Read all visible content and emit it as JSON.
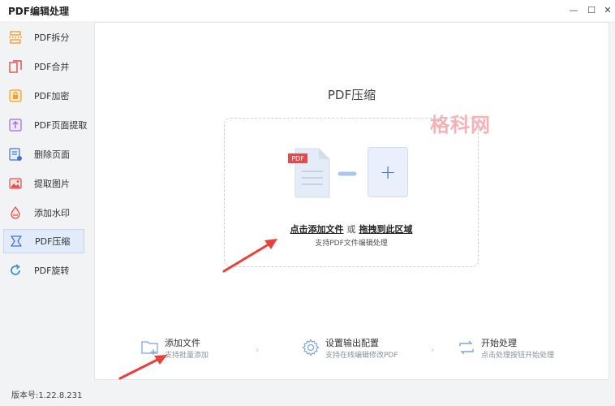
{
  "app": {
    "title": "PDF编辑处理"
  },
  "window": {
    "min_glyph": "—",
    "max_glyph": "☐",
    "close_glyph": "✕"
  },
  "sidebar": {
    "items": [
      {
        "label": "PDF拆分",
        "icon": "split-icon"
      },
      {
        "label": "PDF合并",
        "icon": "merge-icon"
      },
      {
        "label": "PDF加密",
        "icon": "lock-icon"
      },
      {
        "label": "PDF页面提取",
        "icon": "extract-icon"
      },
      {
        "label": "删除页面",
        "icon": "delete-page-icon"
      },
      {
        "label": "提取图片",
        "icon": "image-icon"
      },
      {
        "label": "添加水印",
        "icon": "watermark-icon"
      },
      {
        "label": "PDF压缩",
        "icon": "compress-icon",
        "active": true
      },
      {
        "label": "PDF旋转",
        "icon": "rotate-icon"
      }
    ]
  },
  "main": {
    "title": "PDF压缩",
    "watermark": "格科网",
    "dropzone": {
      "badge": "PDF",
      "plus": "+",
      "click_add": "点击添加文件",
      "or": "或",
      "drag_here": "拖拽到此区域",
      "hint": "支持PDF文件编辑处理"
    },
    "steps": [
      {
        "title": "添加文件",
        "desc": "支持批量添加"
      },
      {
        "title": "设置输出配置",
        "desc": "支持在线编辑修改PDF"
      },
      {
        "title": "开始处理",
        "desc": "点击处理按钮开始处理"
      }
    ],
    "step_separator": "›"
  },
  "footer": {
    "version": "版本号:1.22.8.231"
  },
  "colors": {
    "accent": "#4a74c9",
    "annotation": "#e8403a",
    "watermark": "#f4a9ad"
  }
}
